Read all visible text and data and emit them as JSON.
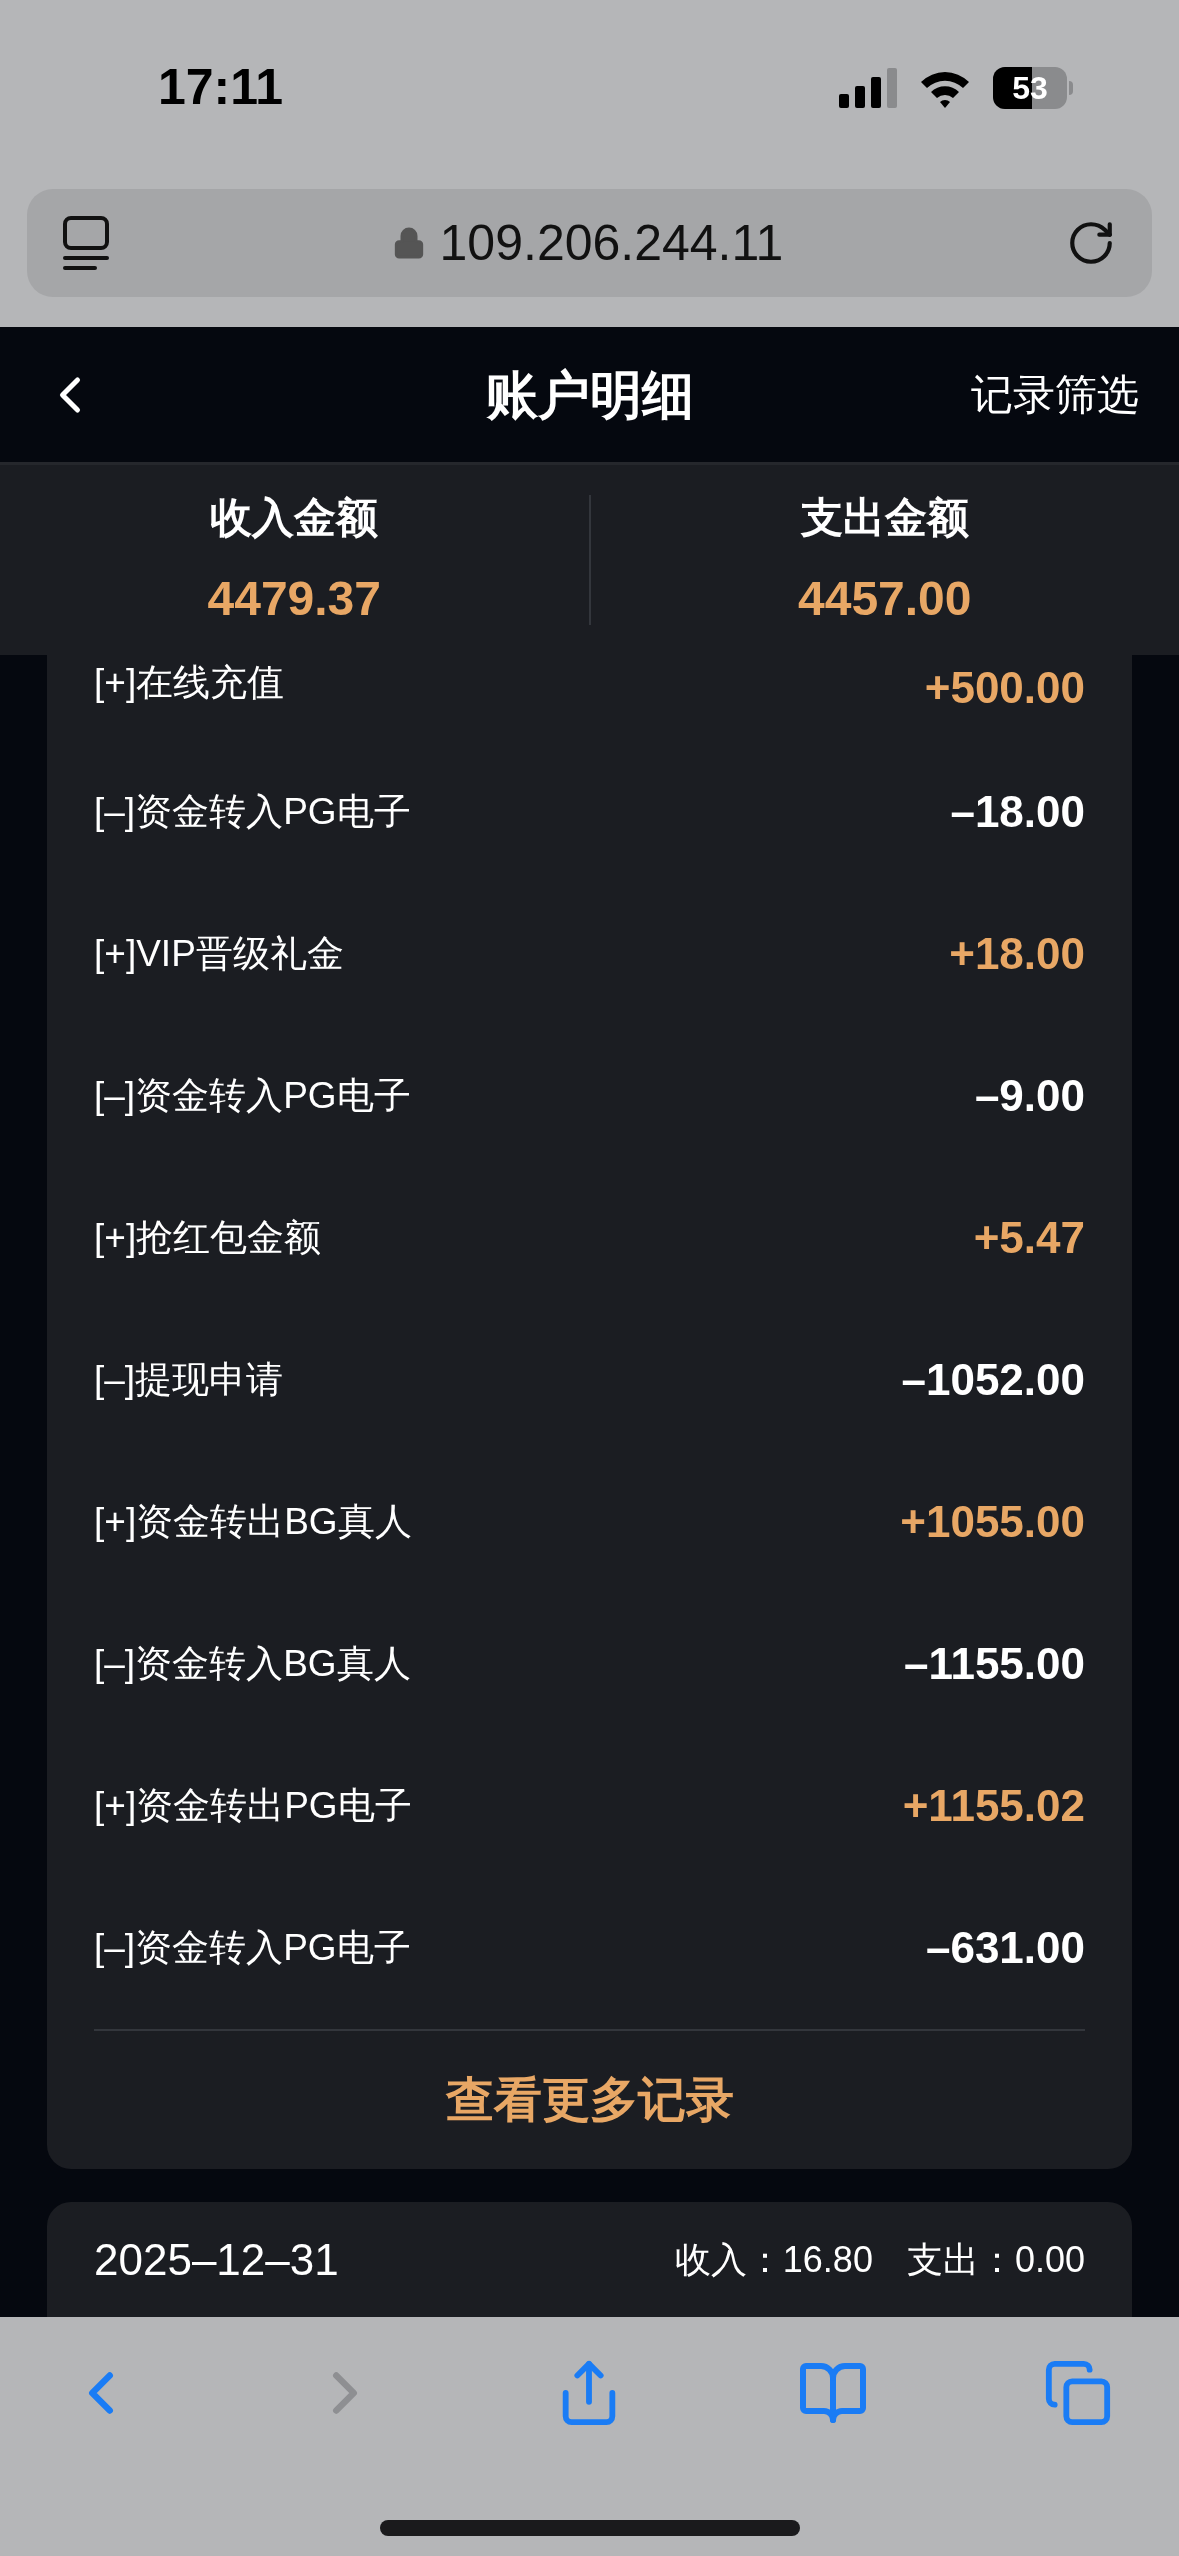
{
  "status_bar": {
    "time": "17:11",
    "battery": "53"
  },
  "browser": {
    "url": "109.206.244.11"
  },
  "header": {
    "title": "账户明细",
    "action": "记录筛选"
  },
  "summary": [
    {
      "label": "收入金额",
      "value": "4479.37"
    },
    {
      "label": "支出金额",
      "value": "4457.00"
    }
  ],
  "records": [
    {
      "kind": "income",
      "label": "[+]在线充值",
      "amount": "+500.00"
    },
    {
      "kind": "expense",
      "label": "[–]资金转入PG电子",
      "amount": "–18.00"
    },
    {
      "kind": "income",
      "label": "[+]VIP晋级礼金",
      "amount": "+18.00"
    },
    {
      "kind": "expense",
      "label": "[–]资金转入PG电子",
      "amount": "–9.00"
    },
    {
      "kind": "income",
      "label": "[+]抢红包金额",
      "amount": "+5.47"
    },
    {
      "kind": "expense",
      "label": "[–]提现申请",
      "amount": "–1052.00"
    },
    {
      "kind": "income",
      "label": "[+]资金转出BG真人",
      "amount": "+1055.00"
    },
    {
      "kind": "expense",
      "label": "[–]资金转入BG真人",
      "amount": "–1155.00"
    },
    {
      "kind": "income",
      "label": "[+]资金转出PG电子",
      "amount": "+1155.02"
    },
    {
      "kind": "expense",
      "label": "[–]资金转入PG电子",
      "amount": "–631.00"
    }
  ],
  "more_button": "查看更多记录",
  "day": {
    "date": "2025–12–31",
    "income": "收入：16.80",
    "expense": "支出：0.00"
  }
}
